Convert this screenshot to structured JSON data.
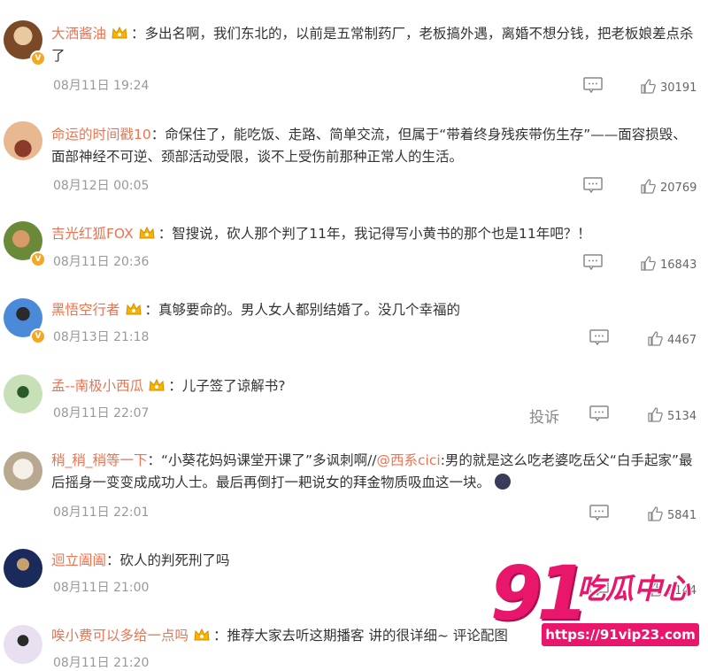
{
  "comments": [
    {
      "username": "大洒酱油",
      "pre": "：多出名啊，我们东北的，以前是五常制药厂，老板搞外遇，离婚不想分钱，把老板娘差点杀了",
      "date": "08月11日 19:24",
      "likes": "30191",
      "avatar_color": "#7a4a28"
    },
    {
      "username": "命运的时间戳10",
      "pre": "：命保住了，能吃饭、走路、简单交流，但属于“带着终身残疾带伤生存”——面容损毁、面部神经不可逆、颈部活动受限，谈不上受伤前那种正常人的生活。",
      "date": "08月12日 00:05",
      "likes": "20769",
      "avatar_color": "#c87a4a"
    },
    {
      "username": "吉光红狐FOX",
      "pre": "：智搜说，砍人那个判了11年，我记得写小黄书的那个也是11年吧？！",
      "date": "08月11日 20:36",
      "likes": "16843",
      "avatar_color": "#6a8a3a"
    },
    {
      "username": "黑悟空行者",
      "pre": "：真够要命的。男人女人都别结婚了。没几个幸福的",
      "date": "08月13日 21:18",
      "likes": "4467",
      "avatar_color": "#3a6aa8"
    },
    {
      "username": "孟--南极小西瓜",
      "pre": "：儿子签了谅解书?",
      "date": "08月11日 22:07",
      "likes": "5134",
      "avatar_color": "#4a8a4a",
      "report": "投诉"
    },
    {
      "username": "稍_稍_稍等一下",
      "pre": "：“小葵花妈妈课堂开课了”多讽刺啊//",
      "mention": "@西系cici",
      "post": ":男的就是这么吃老婆吃岳父“白手起家”最后摇身一变变成成功人士。最后再倒打一耙说女的拜金物质吸血这一块。",
      "date": "08月11日 22:01",
      "likes": "5841",
      "avatar_color": "#d9d2c4"
    },
    {
      "username": "迴立阖阖",
      "pre": "：砍人的判死刑了吗",
      "date": "08月11日 21:00",
      "likes": "2144",
      "avatar_color": "#2a3a6a"
    },
    {
      "username": "唉小费可以多给一点吗",
      "pre": "：推荐大家去听这期播客 讲的很详细~ 评论配图",
      "date": "08月11日 21:20",
      "likes": "",
      "avatar_color": "#e8e0f0"
    }
  ],
  "watermark": {
    "number": "91",
    "text": "吃瓜中心",
    "url": "https://91vip23.com"
  }
}
